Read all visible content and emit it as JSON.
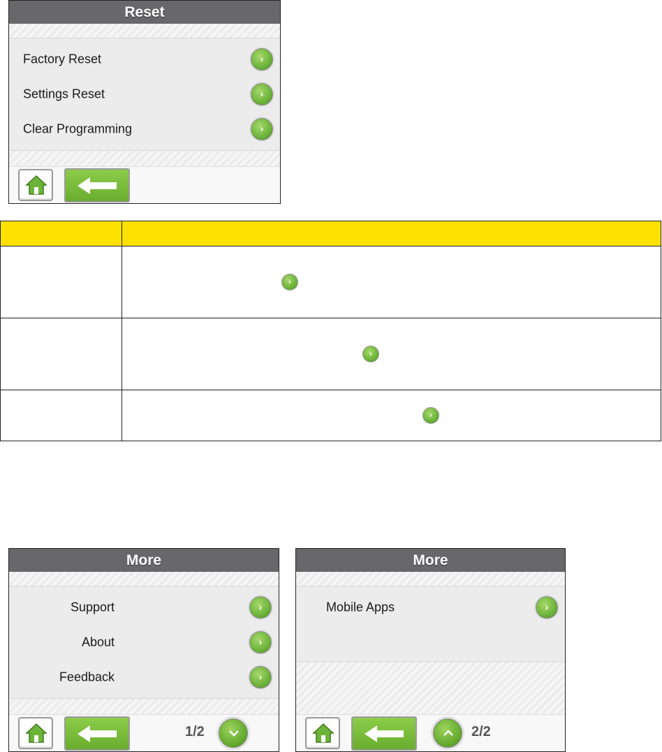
{
  "reset_screen": {
    "title": "Reset",
    "items": [
      {
        "label": "Factory Reset",
        "icon": "chevron-right-icon"
      },
      {
        "label": "Settings Reset",
        "icon": "chevron-right-icon"
      },
      {
        "label": "Clear Programming",
        "icon": "chevron-right-icon"
      }
    ]
  },
  "table": {
    "header": [
      "",
      ""
    ],
    "rows": [
      {
        "col1": "",
        "col2": ""
      },
      {
        "col1": "",
        "col2": ""
      },
      {
        "col1": "",
        "col2": ""
      }
    ]
  },
  "more_screen_1": {
    "title": "More",
    "items": [
      {
        "label": "Support"
      },
      {
        "label": "About"
      },
      {
        "label": "Feedback"
      }
    ],
    "pager": "1/2"
  },
  "more_screen_2": {
    "title": "More",
    "items": [
      {
        "label": "Mobile Apps"
      }
    ],
    "pager": "2/2"
  },
  "colors": {
    "title_bar": "#68686a",
    "accent_green": "#6cb33a",
    "table_header": "#ffe100"
  },
  "chevron": "›"
}
